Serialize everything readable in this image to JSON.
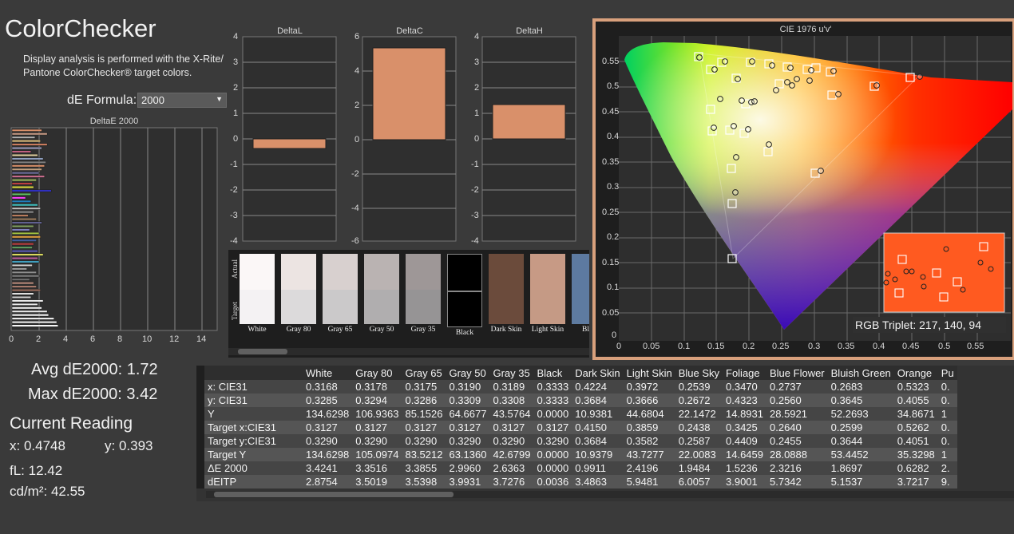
{
  "page": {
    "title": "ColorChecker",
    "description_line1": "Display analysis is performed with the X-Rite/",
    "description_line2": "Pantone ColorChecker® target colors.",
    "formula_label": "dE Formula:",
    "formula_value": "2000"
  },
  "deltae_chart": {
    "title": "DeltaE 2000",
    "xticks": [
      "0",
      "2",
      "4",
      "6",
      "8",
      "10",
      "12",
      "14"
    ]
  },
  "delta_charts": {
    "deltaL": {
      "title": "DeltaL",
      "yticks": [
        "4",
        "3",
        "2",
        "1",
        "0",
        "-1",
        "-2",
        "-3",
        "-4"
      ]
    },
    "deltaC": {
      "title": "DeltaC",
      "yticks": [
        "6",
        "4",
        "2",
        "0",
        "-2",
        "-4",
        "-6"
      ]
    },
    "deltaH": {
      "title": "DeltaH",
      "yticks": [
        "4",
        "3",
        "2",
        "1",
        "0",
        "-1",
        "-2",
        "-3",
        "-4"
      ]
    }
  },
  "stats": {
    "avg": "Avg dE2000: 1.72",
    "max": "Max dE2000: 3.42",
    "current_reading": "Current Reading",
    "x": "x: 0.4748",
    "y": "y: 0.393",
    "fl": "fL: 12.42",
    "cdm2": "cd/m²: 42.55"
  },
  "swatches": {
    "actual_label": "Actual",
    "target_label": "Target",
    "items": [
      {
        "label": "White",
        "actual": "#fbf7f7",
        "target": "#f4f2f3"
      },
      {
        "label": "Gray 80",
        "actual": "#ece4e2",
        "target": "#dcdadb"
      },
      {
        "label": "Gray 65",
        "actual": "#d8d0cf",
        "target": "#cbc9ca"
      },
      {
        "label": "Gray 50",
        "actual": "#bab3b2",
        "target": "#b0aeaf"
      },
      {
        "label": "Gray 35",
        "actual": "#9e9797",
        "target": "#969495"
      },
      {
        "label": "Black",
        "actual": "#000000",
        "target": "#000000"
      },
      {
        "label": "Dark Skin",
        "actual": "#6b4b3b",
        "target": "#6b4b3c"
      },
      {
        "label": "Light Skin",
        "actual": "#c79a85",
        "target": "#c59a85"
      },
      {
        "label": "Blue",
        "actual": "#5d7aa0",
        "target": "#5e7ba0"
      }
    ]
  },
  "table": {
    "columns": [
      "White",
      "Gray 80",
      "Gray 65",
      "Gray 50",
      "Gray 35",
      "Black",
      "Dark Skin",
      "Light Skin",
      "Blue Sky",
      "Foliage",
      "Blue Flower",
      "Bluish Green",
      "Orange",
      "Pu"
    ],
    "rows": [
      {
        "label": "x: CIE31",
        "values": [
          "0.3168",
          "0.3178",
          "0.3175",
          "0.3190",
          "0.3189",
          "0.3333",
          "0.4224",
          "0.3972",
          "0.2539",
          "0.3470",
          "0.2737",
          "0.2683",
          "0.5323",
          "0."
        ]
      },
      {
        "label": "y: CIE31",
        "values": [
          "0.3285",
          "0.3294",
          "0.3286",
          "0.3309",
          "0.3308",
          "0.3333",
          "0.3684",
          "0.3666",
          "0.2672",
          "0.4323",
          "0.2560",
          "0.3645",
          "0.4055",
          "0."
        ]
      },
      {
        "label": "Y",
        "values": [
          "134.6298",
          "106.9363",
          "85.1526",
          "64.6677",
          "43.5764",
          "0.0000",
          "10.9381",
          "44.6804",
          "22.1472",
          "14.8931",
          "28.5921",
          "52.2693",
          "34.8671",
          "1"
        ]
      },
      {
        "label": "Target x:CIE31",
        "values": [
          "0.3127",
          "0.3127",
          "0.3127",
          "0.3127",
          "0.3127",
          "0.3127",
          "0.4150",
          "0.3859",
          "0.2438",
          "0.3425",
          "0.2640",
          "0.2599",
          "0.5262",
          "0."
        ]
      },
      {
        "label": "Target y:CIE31",
        "values": [
          "0.3290",
          "0.3290",
          "0.3290",
          "0.3290",
          "0.3290",
          "0.3290",
          "0.3684",
          "0.3582",
          "0.2587",
          "0.4409",
          "0.2455",
          "0.3644",
          "0.4051",
          "0."
        ]
      },
      {
        "label": "Target Y",
        "values": [
          "134.6298",
          "105.0974",
          "83.5212",
          "63.1360",
          "42.6799",
          "0.0000",
          "10.9379",
          "43.7277",
          "22.0083",
          "14.6459",
          "28.0888",
          "53.4452",
          "35.3298",
          "1"
        ]
      },
      {
        "label": "ΔE 2000",
        "values": [
          "3.4241",
          "3.3516",
          "3.3855",
          "2.9960",
          "2.6363",
          "0.0000",
          "0.9911",
          "2.4196",
          "1.9484",
          "1.5236",
          "2.3216",
          "1.8697",
          "0.6282",
          "2."
        ]
      },
      {
        "label": "dEITP",
        "values": [
          "2.8754",
          "3.5019",
          "3.5398",
          "3.9931",
          "3.7276",
          "0.0036",
          "3.4863",
          "5.9481",
          "6.0057",
          "3.9001",
          "5.7342",
          "5.1537",
          "3.7217",
          "9."
        ]
      }
    ]
  },
  "cie": {
    "title": "CIE 1976 u'v'",
    "rgb_triplet": "RGB Triplet: 217, 140, 94",
    "yticks": [
      "0.55",
      "0.5",
      "0.45",
      "0.4",
      "0.35",
      "0.3",
      "0.25",
      "0.2",
      "0.15",
      "0.1",
      "0.05",
      "0"
    ],
    "xticks": [
      "0",
      "0.05",
      "0.1",
      "0.15",
      "0.2",
      "0.25",
      "0.3",
      "0.35",
      "0.4",
      "0.45",
      "0.5",
      "0.55"
    ]
  },
  "colors": {
    "accent_border": "#d8a07c",
    "bar_fill": "#d9906a"
  }
}
